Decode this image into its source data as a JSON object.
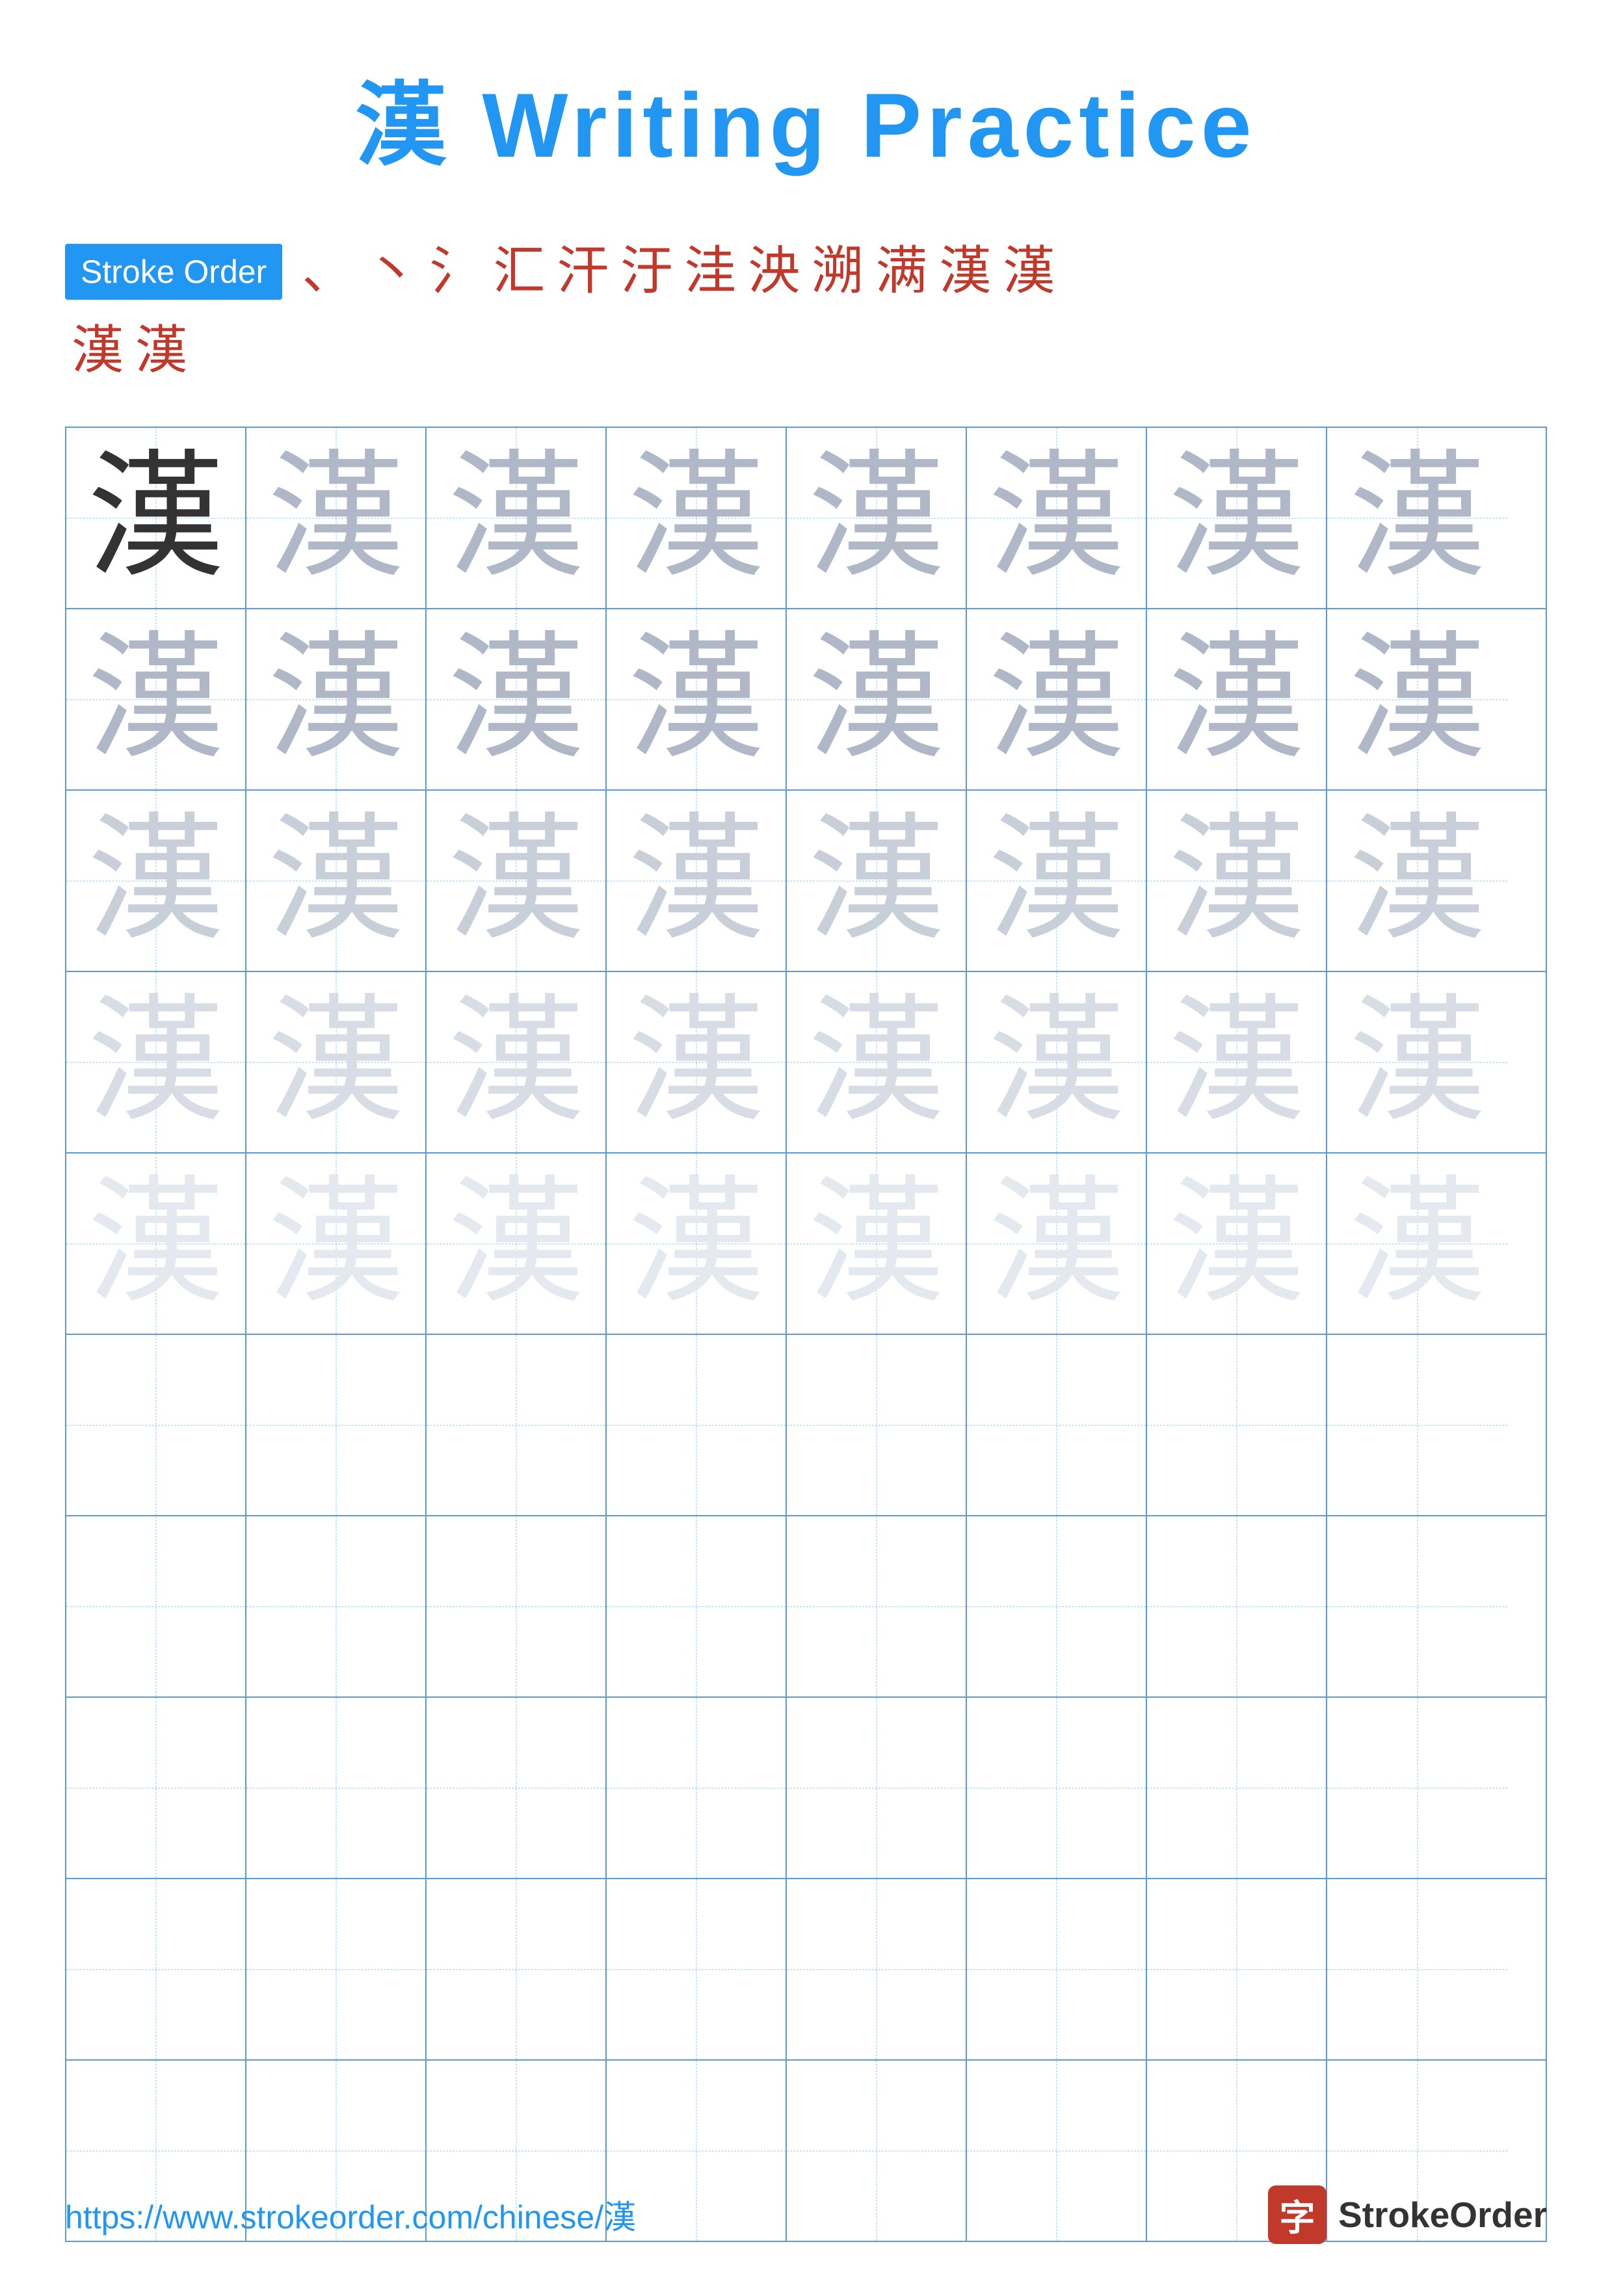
{
  "title": {
    "char": "漢",
    "text": "Writing Practice"
  },
  "stroke_order": {
    "label": "Stroke Order",
    "chars_row1": [
      "、",
      "丶",
      "氵",
      "汇",
      "汗",
      "汙",
      "洼",
      "泱",
      "溯",
      "满",
      "漢",
      "漢"
    ],
    "chars_row2": [
      "漢",
      "漢"
    ]
  },
  "practice_char": "漢",
  "grid": {
    "cols": 8,
    "rows": 10,
    "practice_rows": 5,
    "empty_rows": 5,
    "row_opacities": [
      "dark",
      "light1",
      "light2",
      "light3",
      "light4"
    ]
  },
  "footer": {
    "url": "https://www.strokeorder.com/chinese/漢",
    "logo_char": "字",
    "logo_text": "StrokeOrder"
  }
}
